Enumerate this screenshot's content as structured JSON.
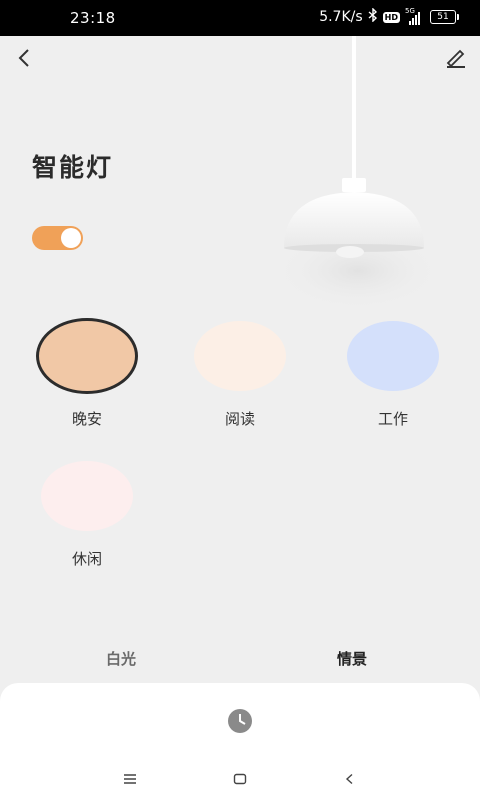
{
  "status_bar": {
    "time": "23:18",
    "net_speed": "5.7K/s",
    "hd_badge": "HD",
    "network": "5G",
    "battery": "51"
  },
  "header": {
    "title": "智能灯",
    "back_icon": "chevron-left-icon",
    "edit_icon": "pen-icon"
  },
  "power": {
    "on": true,
    "accent": "#f0a158"
  },
  "scenes": [
    {
      "label": "晚安",
      "color": "#f1c8a6",
      "selected": true
    },
    {
      "label": "阅读",
      "color": "#fcefe6",
      "selected": false
    },
    {
      "label": "工作",
      "color": "#d4e0fb",
      "selected": false
    },
    {
      "label": "休闲",
      "color": "#fdeeee",
      "selected": false
    }
  ],
  "tabs": {
    "white_light": "白光",
    "scene": "情景",
    "active": "情景"
  },
  "bottom_sheet": {
    "timer_icon": "clock-icon"
  },
  "nav": {
    "menu_icon": "menu-icon",
    "home_icon": "home-icon",
    "back_icon": "back-icon"
  }
}
